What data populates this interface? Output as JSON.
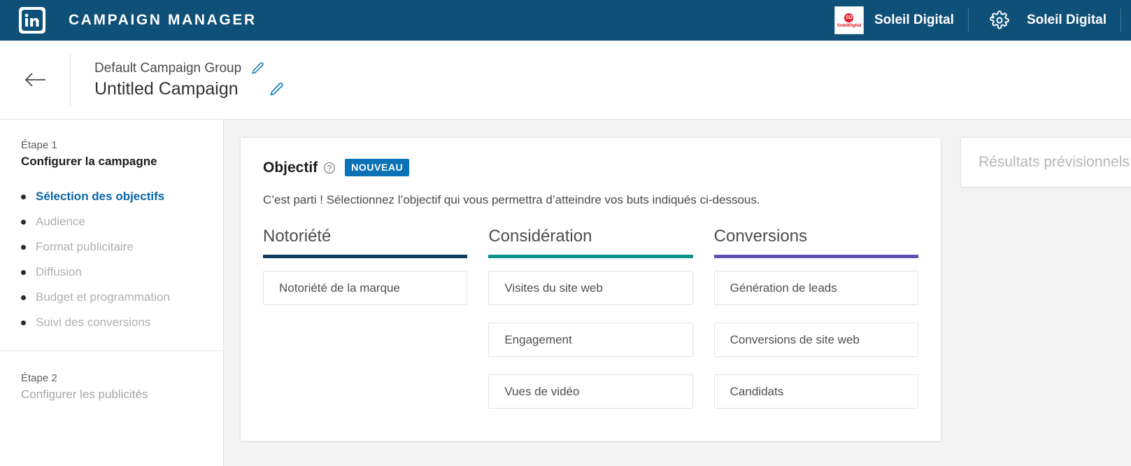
{
  "topbar": {
    "logo_icon": "linkedin-logo-icon",
    "app_title": "CAMPAIGN MANAGER",
    "account": {
      "avatar_badge": "SD",
      "avatar_text": "SoleilDigital",
      "name": "Soleil Digital"
    },
    "settings": {
      "icon": "gear-icon",
      "name": "Soleil Digital"
    }
  },
  "campaign_header": {
    "back_icon": "arrow-left-icon",
    "group_name": "Default Campaign Group",
    "group_edit_icon": "pencil-icon",
    "campaign_name": "Untitled Campaign",
    "campaign_edit_icon": "pencil-icon"
  },
  "sidebar": {
    "step1": {
      "eyebrow": "Étape 1",
      "title": "Configurer la campagne",
      "items": [
        {
          "label": "Sélection des objectifs",
          "active": true
        },
        {
          "label": "Audience",
          "active": false
        },
        {
          "label": "Format publicitaire",
          "active": false
        },
        {
          "label": "Diffusion",
          "active": false
        },
        {
          "label": "Budget et programmation",
          "active": false
        },
        {
          "label": "Suivi des conversions",
          "active": false
        }
      ]
    },
    "step2": {
      "eyebrow": "Étape 2",
      "title": "Configurer les publicités"
    }
  },
  "objective_card": {
    "title": "Objectif",
    "help_icon": "question-mark-circle-icon",
    "badge": "NOUVEAU",
    "description": "C’est parti ! Sélectionnez l’objectif qui vous permettra d’atteindre vos buts indiqués ci-dessous.",
    "columns": [
      {
        "heading": "Notoriété",
        "color": "#0c3d5e",
        "options": [
          "Notoriété de la marque"
        ]
      },
      {
        "heading": "Considération",
        "color": "#11938d",
        "options": [
          "Visites du site web",
          "Engagement",
          "Vues de vidéo"
        ]
      },
      {
        "heading": "Conversions",
        "color": "#5f53b5",
        "options": [
          "Génération de leads",
          "Conversions de site web",
          "Candidats"
        ]
      }
    ]
  },
  "forecast_panel": {
    "title": "Résultats prévisionnels"
  },
  "colors": {
    "header_blue": "#0e5078",
    "accent_blue": "#0a66a8",
    "badge_blue": "#0a72b5",
    "page_bg": "#f3f3f3"
  }
}
